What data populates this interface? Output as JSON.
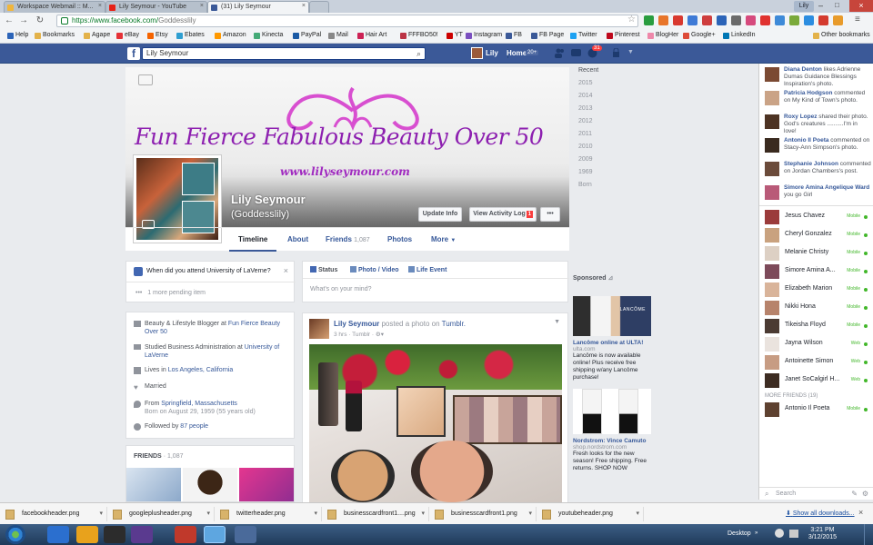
{
  "browser": {
    "tabs": [
      "Workspace Webmail :: M...",
      "Lily Seymour - YouTube",
      "(31) Lily Seymour"
    ],
    "url_host": "https://www.facebook.com/",
    "url_path": "Goddesslily",
    "profile_badge": "Lily",
    "bookmarks": [
      "Help",
      "Bookmarks",
      "Agape",
      "eBay",
      "Etsy",
      "Ebates",
      "Amazon",
      "Kinecta",
      "PayPal",
      "Mail",
      "Hair Art",
      "FFFBO50!",
      "YT",
      "Instagram",
      "FB",
      "FB Page",
      "Twitter",
      "Pinterest",
      "BlogHer",
      "Google+",
      "LinkedIn"
    ],
    "other_bookmarks": "Other bookmarks"
  },
  "fb": {
    "search_value": "Lily Seymour",
    "user_name": "Lily",
    "home_label": "Home",
    "home_count": "20+",
    "notif_count": "31"
  },
  "profile": {
    "cover_title": "Fun Fierce Fabulous Beauty Over 50",
    "cover_url": "www.lilyseymour.com",
    "name": "Lily Seymour",
    "handle": "(Goddesslily)",
    "update_info": "Update Info",
    "view_activity": "View Activity Log",
    "activity_badge": "1",
    "more_dots": "•••",
    "tabs": {
      "timeline": "Timeline",
      "about": "About",
      "friends": "Friends",
      "friends_count": "1,087",
      "photos": "Photos",
      "more": "More"
    }
  },
  "years": [
    "Recent",
    "2015",
    "2014",
    "2013",
    "2012",
    "2011",
    "2010",
    "2009",
    "1969",
    "Born"
  ],
  "question": {
    "text": "When did you attend University of LaVerne?",
    "pending": "1 more pending item"
  },
  "about": {
    "line1_prefix": "Beauty & Lifestyle Blogger at ",
    "line1_link": "Fun Fierce Beauty Over 50",
    "line2_prefix": "Studied Business Administration at ",
    "line2_link": "University of LaVerne",
    "line3_prefix": "Lives in ",
    "line3_link": "Los Angeles, California",
    "line4": "Married",
    "line5_prefix": "From ",
    "line5_link": "Springfield, Massachusetts",
    "line5_sub": "Born on August 29, 1959 (55 years old)",
    "line6_prefix": "Followed by ",
    "line6_link": "87 people"
  },
  "friends_box": {
    "label": "FRIENDS",
    "count": "· 1,087"
  },
  "composer": {
    "status": "Status",
    "photo": "Photo / Video",
    "life": "Life Event",
    "placeholder": "What's on your mind?"
  },
  "post": {
    "author": "Lily Seymour",
    "action": "posted a photo on",
    "target": "Tumblr.",
    "meta": "3 hrs · Tumblr · "
  },
  "sponsored": {
    "label": "Sponsored",
    "ad1_title": "Lancôme online at ULTA!",
    "ad1_domain": "ulta.com",
    "ad1_text": "Lancôme is now available online! Plus receive free shipping w/any Lancôme purchase!",
    "ad1_brand": "LANCÔME",
    "ad2_title": "Nordstrom: Vince Camuto",
    "ad2_domain": "shop.nordstrom.com",
    "ad2_text": "Fresh looks for the new season! Free shipping. Free returns. SHOP NOW"
  },
  "ticker": [
    {
      "name": "Diana Denton",
      "text": "likes Adrienne Dumas Guidance Blessings Inspiration's photo."
    },
    {
      "name": "Patricia Hodgson",
      "text": "commented on My Kind of Town's photo."
    },
    {
      "name": "Roxy Lopez",
      "text": "shared their photo. God's creatures ..........I'm in love!"
    },
    {
      "name": "Antonio Il Poeta",
      "text": "commented on Stacy-Ann Simpson's photo."
    },
    {
      "name": "Stephanie Johnson",
      "text": "commented on Jordan Chambers's post."
    },
    {
      "name": "Simore Amina Angelique Ward",
      "text": "you go Girl"
    }
  ],
  "chat": [
    {
      "name": "Jesus Chavez",
      "status": "Mobile"
    },
    {
      "name": "Cheryl Gonzalez",
      "status": "Mobile"
    },
    {
      "name": "Melanie Christy",
      "status": "Mobile"
    },
    {
      "name": "Simore Amina A...",
      "status": "Mobile"
    },
    {
      "name": "Elizabeth Marion",
      "status": "Mobile"
    },
    {
      "name": "Nikki Hona",
      "status": "Mobile"
    },
    {
      "name": "Tikeisha Floyd",
      "status": "Mobile"
    },
    {
      "name": "Jayna Wilson",
      "status": "Web"
    },
    {
      "name": "Antoinette Simon",
      "status": "Web"
    },
    {
      "name": "Janet SoCalgirl H...",
      "status": "Web"
    }
  ],
  "more_friends": "MORE FRIENDS (19)",
  "more_friend1": {
    "name": "Antonio Il Poeta",
    "status": "Mobile"
  },
  "chat_search": "Search",
  "downloads": [
    "facebookheader.png",
    "googleplusheader.png",
    "twitterheader.png",
    "businesscardfront1....png",
    "businesscardfront1.png",
    "youtubeheader.png"
  ],
  "show_all_downloads": "Show all downloads...",
  "taskbar": {
    "desktop": "Desktop",
    "time": "3:21 PM",
    "date": "3/12/2015"
  },
  "colors": {
    "fb_blue": "#3b5998",
    "link": "#365899",
    "cover_purple": "#8d1fb0",
    "online": "#42b72a"
  }
}
